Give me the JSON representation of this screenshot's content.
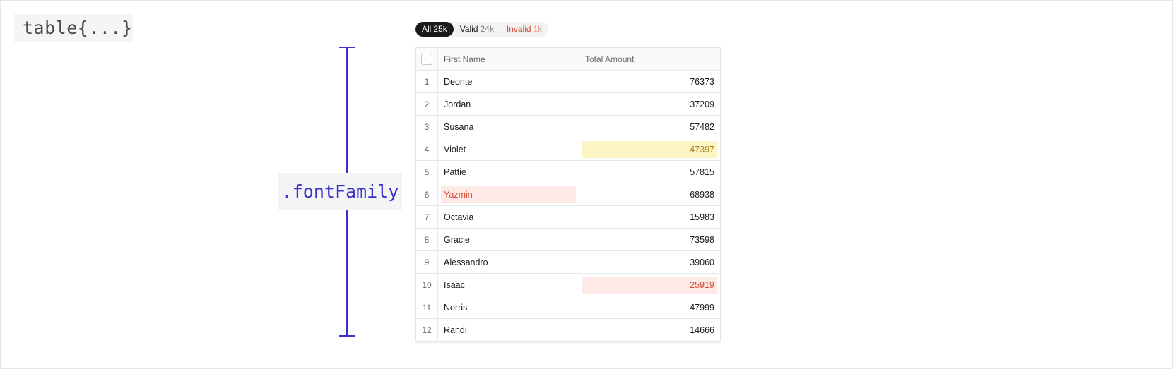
{
  "code_label": "table{...}",
  "property_label": ".fontFamily",
  "filters": [
    {
      "label": "All",
      "count": "25k",
      "kind": "all"
    },
    {
      "label": "Valid",
      "count": "24k",
      "kind": "valid"
    },
    {
      "label": "Invalid",
      "count": "1k",
      "kind": "invalid"
    }
  ],
  "columns": {
    "first_name": "First Name",
    "total_amount": "Total Amount"
  },
  "rows": [
    {
      "index": "1",
      "name": "Deonte",
      "amount": "76373"
    },
    {
      "index": "2",
      "name": "Jordan",
      "amount": "37209"
    },
    {
      "index": "3",
      "name": "Susana",
      "amount": "57482"
    },
    {
      "index": "4",
      "name": "Violet",
      "amount": "47397",
      "amount_status": "warning"
    },
    {
      "index": "5",
      "name": "Pattie",
      "amount": "57815"
    },
    {
      "index": "6",
      "name": "Yazmin",
      "amount": "68938",
      "name_status": "error"
    },
    {
      "index": "7",
      "name": "Octavia",
      "amount": "15983"
    },
    {
      "index": "8",
      "name": "Gracie",
      "amount": "73598"
    },
    {
      "index": "9",
      "name": "Alessandro",
      "amount": "39060"
    },
    {
      "index": "10",
      "name": "Isaac",
      "amount": "25919",
      "amount_status": "error"
    },
    {
      "index": "11",
      "name": "Norris",
      "amount": "47999"
    },
    {
      "index": "12",
      "name": "Randi",
      "amount": "14666"
    }
  ],
  "colors": {
    "accent": "#3b2fc9",
    "warning_bg": "#fdf5c4",
    "warning_text": "#b07a1d",
    "error_bg": "#fde9e5",
    "error_text": "#d94b35"
  },
  "icons": {
    "select_all": "checkbox-icon"
  }
}
